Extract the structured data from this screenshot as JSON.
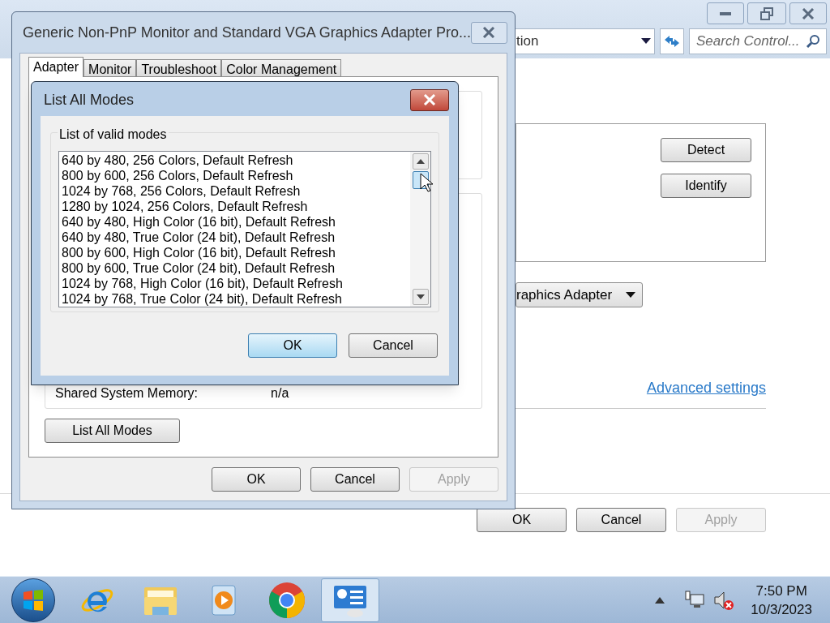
{
  "control_panel": {
    "address": "tion",
    "search": {
      "placeholder": "Search Control..."
    },
    "side_buttons": [
      "Detect",
      "Identify"
    ],
    "display_dropdown": "raphics Adapter",
    "link": "Advanced settings",
    "footer_buttons": [
      {
        "label": "OK",
        "disabled": false
      },
      {
        "label": "Cancel",
        "disabled": false
      },
      {
        "label": "Apply",
        "disabled": true
      }
    ]
  },
  "properties_dialog": {
    "title": "Generic Non-PnP Monitor and Standard VGA Graphics Adapter Pro...",
    "tabs": [
      {
        "label": "Adapter",
        "selected": true
      },
      {
        "label": "Monitor",
        "selected": false
      },
      {
        "label": "Troubleshoot",
        "selected": false
      },
      {
        "label": "Color Management",
        "selected": false
      }
    ],
    "memory_label": "Shared System Memory:",
    "memory_value": "n/a",
    "list_modes_button": "List All Modes",
    "buttons": [
      {
        "label": "OK",
        "disabled": false
      },
      {
        "label": "Cancel",
        "disabled": false
      },
      {
        "label": "Apply",
        "disabled": true
      }
    ]
  },
  "modes_dialog": {
    "title": "List All Modes",
    "group_label": "List of valid modes",
    "modes": [
      "640 by 480, 256 Colors, Default Refresh",
      "800 by 600, 256 Colors, Default Refresh",
      "1024 by 768, 256 Colors, Default Refresh",
      "1280 by 1024, 256 Colors, Default Refresh",
      "640 by 480, High Color (16 bit), Default Refresh",
      "640 by 480, True Color (24 bit), Default Refresh",
      "800 by 600, High Color (16 bit), Default Refresh",
      "800 by 600, True Color (24 bit), Default Refresh",
      "1024 by 768, High Color (16 bit), Default Refresh",
      "1024 by 768, True Color (24 bit), Default Refresh"
    ],
    "buttons": [
      {
        "label": "OK",
        "default": true
      },
      {
        "label": "Cancel",
        "default": false
      }
    ]
  },
  "taskbar": {
    "apps": [
      {
        "kind": "browser-e",
        "active": false
      },
      {
        "kind": "folder",
        "active": false
      },
      {
        "kind": "media",
        "active": false
      },
      {
        "kind": "chrome",
        "active": false
      },
      {
        "kind": "panel",
        "active": true
      }
    ],
    "clock": {
      "time": "7:50 PM",
      "date": "10/3/2023"
    }
  }
}
